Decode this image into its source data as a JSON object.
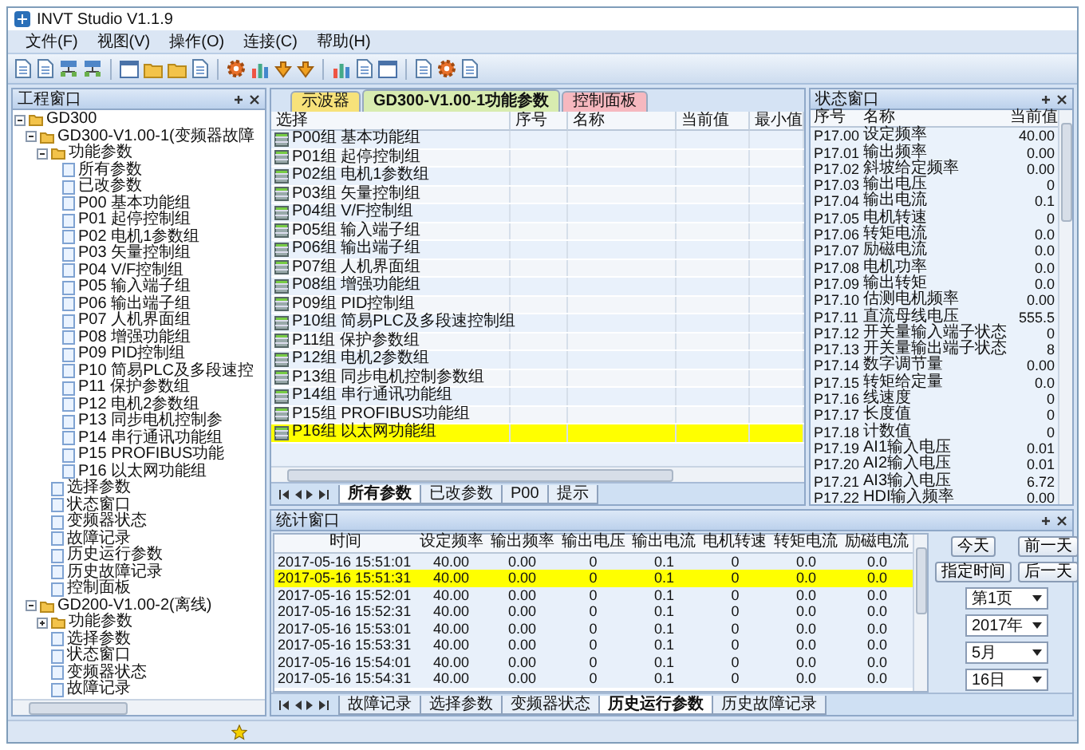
{
  "window": {
    "title": "INVT Studio V1.1.9"
  },
  "menu": [
    "文件(F)",
    "视图(V)",
    "操作(O)",
    "连接(C)",
    "帮助(H)"
  ],
  "project_panel": {
    "title": "工程窗口",
    "tree": [
      {
        "label": "GD300",
        "expanded": true,
        "children": [
          {
            "label": "GD300-V1.00-1(变频器故障",
            "expanded": true,
            "children": [
              {
                "label": "功能参数",
                "expanded": true,
                "children": [
                  {
                    "label": "所有参数"
                  },
                  {
                    "label": "已改参数"
                  },
                  {
                    "label": "P00 基本功能组"
                  },
                  {
                    "label": "P01 起停控制组"
                  },
                  {
                    "label": "P02 电机1参数组"
                  },
                  {
                    "label": "P03 矢量控制组"
                  },
                  {
                    "label": "P04 V/F控制组"
                  },
                  {
                    "label": "P05 输入端子组"
                  },
                  {
                    "label": "P06 输出端子组"
                  },
                  {
                    "label": "P07 人机界面组"
                  },
                  {
                    "label": "P08 增强功能组"
                  },
                  {
                    "label": "P09 PID控制组"
                  },
                  {
                    "label": "P10 简易PLC及多段速控"
                  },
                  {
                    "label": "P11 保护参数组"
                  },
                  {
                    "label": "P12 电机2参数组"
                  },
                  {
                    "label": "P13 同步电机控制参"
                  },
                  {
                    "label": "P14 串行通讯功能组"
                  },
                  {
                    "label": "P15 PROFIBUS功能"
                  },
                  {
                    "label": "P16 以太网功能组"
                  }
                ]
              },
              {
                "label": "选择参数"
              },
              {
                "label": "状态窗口"
              },
              {
                "label": "变频器状态"
              },
              {
                "label": "故障记录"
              },
              {
                "label": "历史运行参数"
              },
              {
                "label": "历史故障记录"
              },
              {
                "label": "控制面板"
              }
            ]
          },
          {
            "label": "GD200-V1.00-2(离线)",
            "expanded": true,
            "children": [
              {
                "label": "功能参数",
                "expanded": false
              },
              {
                "label": "选择参数"
              },
              {
                "label": "状态窗口"
              },
              {
                "label": "变频器状态"
              },
              {
                "label": "故障记录"
              }
            ]
          }
        ]
      }
    ]
  },
  "document_tabs": [
    {
      "label": "示波器",
      "selected": false,
      "color": "#f7e27a"
    },
    {
      "label": "GD300-V1.00-1功能参数",
      "selected": true,
      "color": "#d8ecb0"
    },
    {
      "label": "控制面板",
      "selected": false,
      "color": "#f6b8bf"
    }
  ],
  "param_table": {
    "columns": [
      "选择",
      "序号",
      "名称",
      "当前值",
      "最小值"
    ],
    "rows": [
      {
        "label": "P00组 基本功能组",
        "selected": false
      },
      {
        "label": "P01组 起停控制组",
        "selected": false
      },
      {
        "label": "P02组 电机1参数组",
        "selected": false
      },
      {
        "label": "P03组 矢量控制组",
        "selected": false
      },
      {
        "label": "P04组 V/F控制组",
        "selected": false
      },
      {
        "label": "P05组 输入端子组",
        "selected": false
      },
      {
        "label": "P06组 输出端子组",
        "selected": false
      },
      {
        "label": "P07组 人机界面组",
        "selected": false
      },
      {
        "label": "P08组 增强功能组",
        "selected": false
      },
      {
        "label": "P09组 PID控制组",
        "selected": false
      },
      {
        "label": "P10组 简易PLC及多段速控制组",
        "selected": false
      },
      {
        "label": "P11组 保护参数组",
        "selected": false
      },
      {
        "label": "P12组 电机2参数组",
        "selected": false
      },
      {
        "label": "P13组 同步电机控制参数组",
        "selected": false
      },
      {
        "label": "P14组 串行通讯功能组",
        "selected": false
      },
      {
        "label": "P15组 PROFIBUS功能组",
        "selected": false
      },
      {
        "label": "P16组 以太网功能组",
        "selected": true
      }
    ]
  },
  "param_sheet_tabs": [
    {
      "label": "所有参数",
      "selected": true
    },
    {
      "label": "已改参数",
      "selected": false
    },
    {
      "label": "P00",
      "selected": false
    },
    {
      "label": "提示",
      "selected": false
    }
  ],
  "status_panel": {
    "title": "状态窗口",
    "columns": [
      "序号",
      "名称",
      "当前值"
    ],
    "rows": [
      {
        "code": "P17.00",
        "name": "设定频率",
        "value": "40.00"
      },
      {
        "code": "P17.01",
        "name": "输出频率",
        "value": "0.00"
      },
      {
        "code": "P17.02",
        "name": "斜坡给定频率",
        "value": "0.00"
      },
      {
        "code": "P17.03",
        "name": "输出电压",
        "value": "0"
      },
      {
        "code": "P17.04",
        "name": "输出电流",
        "value": "0.1"
      },
      {
        "code": "P17.05",
        "name": "电机转速",
        "value": "0"
      },
      {
        "code": "P17.06",
        "name": "转矩电流",
        "value": "0.0"
      },
      {
        "code": "P17.07",
        "name": "励磁电流",
        "value": "0.0"
      },
      {
        "code": "P17.08",
        "name": "电机功率",
        "value": "0.0"
      },
      {
        "code": "P17.09",
        "name": "输出转矩",
        "value": "0.0"
      },
      {
        "code": "P17.10",
        "name": "估测电机频率",
        "value": "0.00"
      },
      {
        "code": "P17.11",
        "name": "直流母线电压",
        "value": "555.5"
      },
      {
        "code": "P17.12",
        "name": "开关量输入端子状态",
        "value": "0"
      },
      {
        "code": "P17.13",
        "name": "开关量输出端子状态",
        "value": "8"
      },
      {
        "code": "P17.14",
        "name": "数字调节量",
        "value": "0.00"
      },
      {
        "code": "P17.15",
        "name": "转矩给定量",
        "value": "0.0"
      },
      {
        "code": "P17.16",
        "name": "线速度",
        "value": "0"
      },
      {
        "code": "P17.17",
        "name": "长度值",
        "value": "0"
      },
      {
        "code": "P17.18",
        "name": "计数值",
        "value": "0"
      },
      {
        "code": "P17.19",
        "name": "AI1输入电压",
        "value": "0.01"
      },
      {
        "code": "P17.20",
        "name": "AI2输入电压",
        "value": "0.01"
      },
      {
        "code": "P17.21",
        "name": "AI3输入电压",
        "value": "6.72"
      },
      {
        "code": "P17.22",
        "name": "HDI输入频率",
        "value": "0.00"
      }
    ]
  },
  "stats_panel": {
    "title": "统计窗口",
    "columns": [
      "时间",
      "设定频率",
      "输出频率",
      "输出电压",
      "输出电流",
      "电机转速",
      "转矩电流",
      "励磁电流"
    ],
    "rows": [
      {
        "cells": [
          "2017-05-16 15:51:01",
          "40.00",
          "0.00",
          "0",
          "0.1",
          "0",
          "0.0",
          "0.0"
        ],
        "selected": false
      },
      {
        "cells": [
          "2017-05-16 15:51:31",
          "40.00",
          "0.00",
          "0",
          "0.1",
          "0",
          "0.0",
          "0.0"
        ],
        "selected": true
      },
      {
        "cells": [
          "2017-05-16 15:52:01",
          "40.00",
          "0.00",
          "0",
          "0.1",
          "0",
          "0.0",
          "0.0"
        ],
        "selected": false
      },
      {
        "cells": [
          "2017-05-16 15:52:31",
          "40.00",
          "0.00",
          "0",
          "0.1",
          "0",
          "0.0",
          "0.0"
        ],
        "selected": false
      },
      {
        "cells": [
          "2017-05-16 15:53:01",
          "40.00",
          "0.00",
          "0",
          "0.1",
          "0",
          "0.0",
          "0.0"
        ],
        "selected": false
      },
      {
        "cells": [
          "2017-05-16 15:53:31",
          "40.00",
          "0.00",
          "0",
          "0.1",
          "0",
          "0.0",
          "0.0"
        ],
        "selected": false
      },
      {
        "cells": [
          "2017-05-16 15:54:01",
          "40.00",
          "0.00",
          "0",
          "0.1",
          "0",
          "0.0",
          "0.0"
        ],
        "selected": false
      },
      {
        "cells": [
          "2017-05-16 15:54:31",
          "40.00",
          "0.00",
          "0",
          "0.1",
          "0",
          "0.0",
          "0.0"
        ],
        "selected": false
      }
    ],
    "buttons": [
      "今天",
      "前一天",
      "指定时间",
      "后一天"
    ],
    "dropdowns": [
      "第1页",
      "2017年",
      "5月",
      "16日"
    ],
    "sheet_tabs": [
      {
        "label": "故障记录",
        "selected": false
      },
      {
        "label": "选择参数",
        "selected": false
      },
      {
        "label": "变频器状态",
        "selected": false
      },
      {
        "label": "历史运行参数",
        "selected": true
      },
      {
        "label": "历史故障记录",
        "selected": false
      }
    ]
  }
}
